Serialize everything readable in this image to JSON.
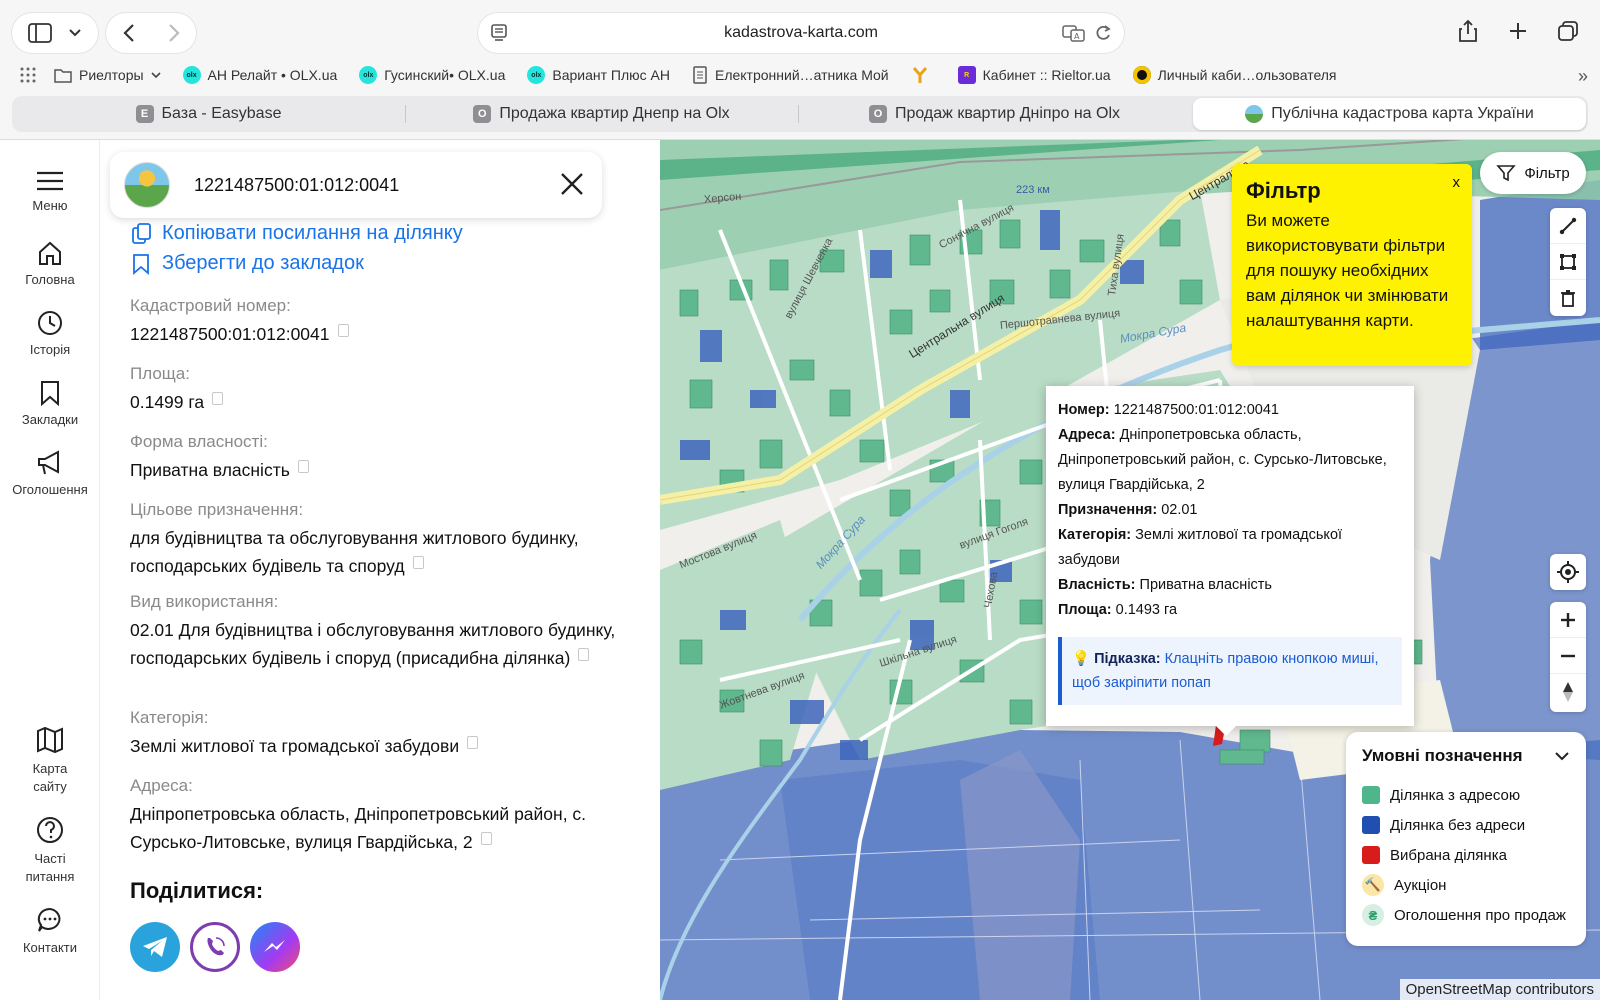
{
  "browser": {
    "url": "kadastrova-karta.com",
    "bookmarks": [
      {
        "label": "Риелторы",
        "icon": "folder-icon"
      },
      {
        "label": "АН Релайт • OLX.ua",
        "icon": "olx-icon"
      },
      {
        "label": "Гусинский• OLX.ua",
        "icon": "olx-icon"
      },
      {
        "label": "Вариант Плюс АН",
        "icon": "olx-icon"
      },
      {
        "label": "Електронний…атника Мой",
        "icon": "document-icon"
      },
      {
        "label": "",
        "icon": "fork-icon"
      },
      {
        "label": "Кабинет :: Rieltor.ua",
        "icon": "rieltor-icon"
      },
      {
        "label": "Личный каби…ользователя",
        "icon": "circle-logo-icon"
      }
    ],
    "tabs": [
      {
        "label": "База - Easybase",
        "icon_letter": "E",
        "active": false
      },
      {
        "label": "Продажа квартир Днепр на Olx",
        "icon_letter": "O",
        "active": false
      },
      {
        "label": "Продаж квартир Дніпро на Olx",
        "icon_letter": "O",
        "active": false
      },
      {
        "label": "Публічна кадастрова карта України",
        "icon_letter": "",
        "active": true
      }
    ]
  },
  "rail": {
    "menu": "Меню",
    "home": "Головна",
    "history": "Історія",
    "bookmarks": "Закладки",
    "ads": "Оголошення",
    "sitemap": "Карта сайту",
    "faq": "Часті питання",
    "contacts": "Контакти"
  },
  "panel": {
    "search_value": "1221487500:01:012:0041",
    "copy_link": "Копіювати посилання на ділянку",
    "save_bookmark": "Зберегти до закладок",
    "fields": [
      {
        "label": "Кадастровий номер:",
        "value": "1221487500:01:012:0041"
      },
      {
        "label": "Площа:",
        "value": "0.1499 га"
      },
      {
        "label": "Форма власності:",
        "value": "Приватна власність"
      },
      {
        "label": "Цільове призначення:",
        "value": "для будівництва та обслуговування житлового будинку, господарських будівель та споруд"
      },
      {
        "label": "Вид використання:",
        "value": "02.01 Для будівництва і обслуговування житлового будинку, господарських будівель і споруд (присадибна ділянка)"
      },
      {
        "label": "Категорія:",
        "value": "Землі житлової та громадської забудови"
      },
      {
        "label": "Адреса:",
        "value": "Дніпропетровська область, Дніпропетровський район, с. Сурсько-Литовське, вулиця Гвардійська, 2"
      }
    ],
    "share_title": "Поділитися:"
  },
  "map": {
    "filter_button": "Фільтр",
    "filter_tip": {
      "title": "Фільтр",
      "body": "Ви можете використовувати фільтри для пошуку необхідних вам ділянок чи змінювати налаштування карти.",
      "close": "x"
    },
    "popup": {
      "number_label": "Номер:",
      "number": "1221487500:01:012:0041",
      "address_label": "Адреса:",
      "address": "Дніпропетровська область, Дніпропетровський район, с. Сурсько-Литовське, вулиця Гвардійська, 2",
      "purpose_label": "Призначення:",
      "purpose": "02.01",
      "category_label": "Категорія:",
      "category": "Землі житлової та громадської забудови",
      "ownership_label": "Власність:",
      "ownership": "Приватна власність",
      "area_label": "Площа:",
      "area": "0.1493 га",
      "hint_label": "Підказка:",
      "hint": "Клацніть правою кнопкою миші, щоб закріпити попап"
    },
    "legend": {
      "title": "Умовні позначення",
      "items": [
        {
          "label": "Ділянка з адресою",
          "color": "#4fb58a"
        },
        {
          "label": "Ділянка без адреси",
          "color": "#1f4fb0"
        },
        {
          "label": "Вибрана ділянка",
          "color": "#d81b1b"
        },
        {
          "label": "Аукціон",
          "color": "#f5c542"
        },
        {
          "label": "Оголошення про продаж",
          "color": "#2a9d6b"
        }
      ]
    },
    "labels": {
      "rail_km": "223 км",
      "kherson": "Херсон",
      "central_street": "Центральна вулиця",
      "central_street_2": "Центральна",
      "mokra_sura": "Мокра Сура",
      "mokra_sura_2": "Мокра Сура",
      "pershotravneva": "Першотравнева вулиця",
      "gogol": "вулиця Гоголя",
      "shevchenko": "вулиця Шевченка",
      "chekhov": "Чехова",
      "tikha": "Тиха вулиця",
      "sonyachna": "Сонячна вулиця",
      "mostova": "Мостова вулиця",
      "zhovtneva": "Жовтнева вулиця",
      "shkilna": "Шкільна вулиця"
    },
    "attribution": "OpenStreetMap contributors"
  },
  "colors": {
    "accent": "#1a73e8",
    "parcel_address": "#4fb58a",
    "parcel_no_address": "#1f4fb0",
    "tip_yellow": "#fff200"
  }
}
